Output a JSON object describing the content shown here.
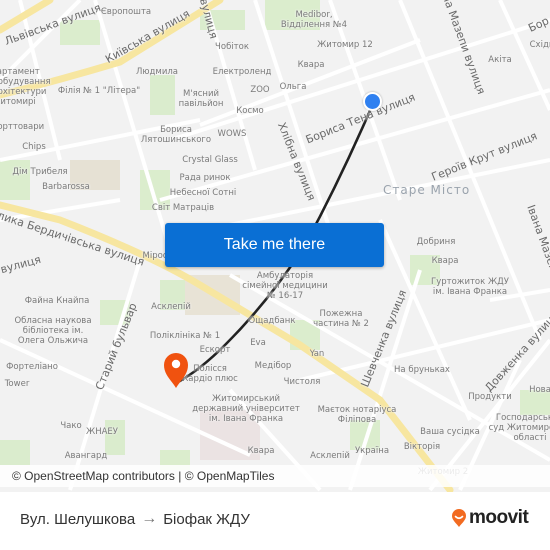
{
  "map": {
    "districts": [
      {
        "name": "Старе Місто"
      }
    ],
    "streets": [
      {
        "name": "Львівська вулиця"
      },
      {
        "name": "Київська вулиця"
      },
      {
        "name": "вулиця"
      },
      {
        "name": "Івана Мазепи вулиця"
      },
      {
        "name": "Бориса Тена вулиця"
      },
      {
        "name": "Хлібна вулиця"
      },
      {
        "name": "Героїв Крут вулиця"
      },
      {
        "name": "Велика Бердичівська вулиця"
      },
      {
        "name": "вулиця"
      },
      {
        "name": "Старий бульвар"
      },
      {
        "name": "Шевченка вулиця"
      },
      {
        "name": "Довженка вулиця"
      },
      {
        "name": "Івана Мазепи"
      },
      {
        "name": "Бор"
      }
    ],
    "pois": [
      {
        "name": "Європошта"
      },
      {
        "name": "Medibor,\nВідділення №4"
      },
      {
        "name": "Житомир 12"
      },
      {
        "name": "Чобіток"
      },
      {
        "name": "Квара"
      },
      {
        "name": "Акіта"
      },
      {
        "name": "Східн"
      },
      {
        "name": "Людмила"
      },
      {
        "name": "Електроленд"
      },
      {
        "name": "ZOO"
      },
      {
        "name": "Ольга"
      },
      {
        "name": "М'ясний\nпавільйон"
      },
      {
        "name": "Космо"
      },
      {
        "name": "Департамент\nмістобудування\nта архітектури\nм. Житомирі"
      },
      {
        "name": "Філія № 1 \"Літера\""
      },
      {
        "name": "Спорттовари"
      },
      {
        "name": "Бориса\nЛятошинського"
      },
      {
        "name": "WOWS"
      },
      {
        "name": "Chips"
      },
      {
        "name": "Crystal Glass"
      },
      {
        "name": "Дім Трибеля"
      },
      {
        "name": "Рада ринок"
      },
      {
        "name": "Barbarossa"
      },
      {
        "name": "Небесної Сотні"
      },
      {
        "name": "Світ Матраців"
      },
      {
        "name": "Мірос"
      },
      {
        "name": "Добриня"
      },
      {
        "name": "Квара"
      },
      {
        "name": "Амбулаторія\nсімейної медицини\n№ 16-17"
      },
      {
        "name": "Гуртожиток ЖДУ\nім. Івана Франка"
      },
      {
        "name": "Файна Кнайпа"
      },
      {
        "name": "Асклепій"
      },
      {
        "name": "Ощадбанк"
      },
      {
        "name": "Обласна наукова\nбібліотека ім.\nОлега Ольжича"
      },
      {
        "name": "Поліклініка № 1"
      },
      {
        "name": "Пожежна\nчастина № 2"
      },
      {
        "name": "Eva"
      },
      {
        "name": "Ескорт"
      },
      {
        "name": "Yan"
      },
      {
        "name": "Фортеліано"
      },
      {
        "name": "Полісся\nКардіо плюс"
      },
      {
        "name": "Медібор"
      },
      {
        "name": "Чистоля"
      },
      {
        "name": "На бруньках"
      },
      {
        "name": "Tower"
      },
      {
        "name": "Продукти"
      },
      {
        "name": "Нова"
      },
      {
        "name": "Житомирський\nдержавний університет\nім. Івана Франка"
      },
      {
        "name": "Маєток нотаріуса\nФіліпова"
      },
      {
        "name": "Господарський\nсуд Житомирської\nобласті"
      },
      {
        "name": "Чако"
      },
      {
        "name": "ЖНАЕУ"
      },
      {
        "name": "Ваша сусідка"
      },
      {
        "name": "Авангард"
      },
      {
        "name": "Квара"
      },
      {
        "name": "Асклепій"
      },
      {
        "name": "Україна"
      },
      {
        "name": "Вікторія"
      },
      {
        "name": "Житомир 2"
      }
    ],
    "cta_label": "Take me there",
    "attribution": "© OpenStreetMap contributors | © OpenMapTiles",
    "origin_marker": {
      "icon": "current-location-dot",
      "color": "#2f80f0"
    },
    "destination_marker": {
      "icon": "map-pin-icon",
      "color": "#f0520f"
    },
    "route_line_color": "#222222"
  },
  "footer": {
    "from": "Вул. Шелушкова",
    "arrow": "→",
    "to": "Біофак ЖДУ",
    "brand": "moovit",
    "brand_color": "#f26b21"
  }
}
